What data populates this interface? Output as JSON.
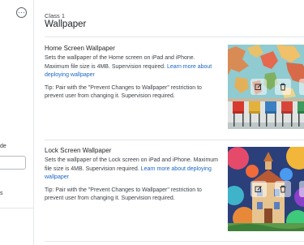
{
  "sidebar": {
    "more_icon": "more-horizontal-icon",
    "label_partial": "de",
    "label_partial_2": "s"
  },
  "header": {
    "class_label": "Class 1",
    "title": "Wallpaper"
  },
  "sections": [
    {
      "title": "Home Screen Wallpaper",
      "description": "Sets the wallpaper of the Home screen on iPad and iPhone. Maximum file size is 4MB. Supervision required.",
      "link": "Learn more about deploying wallpaper",
      "tip": "Tip: Pair with the \"Prevent Changes to Wallpaper\" restriction to prevent user from changing it. Supervision required.",
      "edit_icon": "edit-icon",
      "delete_icon": "trash-icon"
    },
    {
      "title": "Lock Screen Wallpaper",
      "description": "Sets the wallpaper of the Lock screen on iPad and iPhone. Maximum file size is 4MB. Supervision required.",
      "link": "Learn more about deploying wallpaper",
      "tip": "Tip: Pair with the \"Prevent Changes to Wallpaper\" restriction to prevent user from changing it. Supervision required.",
      "edit_icon": "edit-icon",
      "delete_icon": "trash-icon"
    }
  ],
  "colors": {
    "link": "#1a66c9",
    "divider": "#e4e6ea",
    "text": "#1f2328"
  }
}
